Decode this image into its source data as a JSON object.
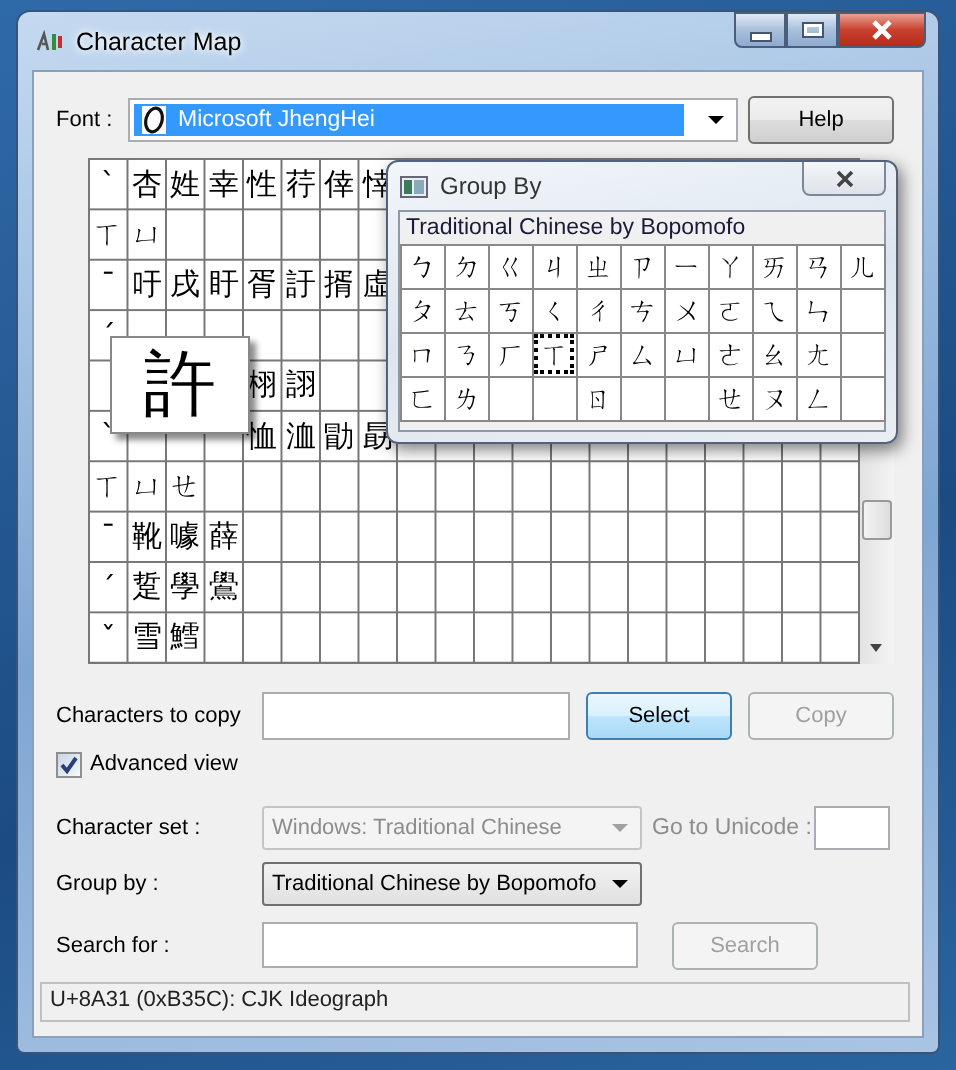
{
  "window": {
    "title": "Character Map"
  },
  "font": {
    "label": "Font :",
    "value": "Microsoft JhengHei"
  },
  "help_button": {
    "label": "Help",
    "disabled": false
  },
  "grid": {
    "rows": [
      [
        {
          "kind": "char",
          "text": "ˋ"
        },
        {
          "kind": "char",
          "text": "杏"
        },
        {
          "kind": "char",
          "text": "姓"
        },
        {
          "kind": "char",
          "text": "幸"
        },
        {
          "kind": "char",
          "text": "性"
        },
        {
          "kind": "char",
          "text": "荇"
        },
        {
          "kind": "char",
          "text": "倖"
        },
        {
          "kind": "char",
          "text": "悻"
        }
      ],
      [
        {
          "kind": "char",
          "text": "ㄒ"
        },
        {
          "kind": "char",
          "text": "ㄩ"
        }
      ],
      [
        {
          "kind": "char",
          "text": "ˉ"
        },
        {
          "kind": "char",
          "text": "吁"
        },
        {
          "kind": "char",
          "text": "戌"
        },
        {
          "kind": "char",
          "text": "盱"
        },
        {
          "kind": "char",
          "text": "胥"
        },
        {
          "kind": "char",
          "text": "訏"
        },
        {
          "kind": "char",
          "text": "揟"
        },
        {
          "kind": "char",
          "text": "虛"
        }
      ],
      [
        {
          "kind": "char",
          "text": "ˊ"
        }
      ],
      [
        {
          "kind": "blank"
        },
        {
          "kind": "blank"
        },
        {
          "kind": "blank"
        },
        {
          "kind": "blank"
        },
        {
          "kind": "char",
          "text": "栩"
        },
        {
          "kind": "char",
          "text": "詡"
        }
      ],
      [
        {
          "kind": "char",
          "text": "ˋ"
        },
        {
          "kind": "blank"
        },
        {
          "kind": "blank"
        },
        {
          "kind": "blank"
        },
        {
          "kind": "char",
          "text": "恤"
        },
        {
          "kind": "char",
          "text": "洫"
        },
        {
          "kind": "char",
          "text": "勖"
        },
        {
          "kind": "char",
          "text": "勗"
        }
      ],
      [
        {
          "kind": "char",
          "text": "ㄒ"
        },
        {
          "kind": "char",
          "text": "ㄩ"
        },
        {
          "kind": "char",
          "text": "ㄝ"
        }
      ],
      [
        {
          "kind": "char",
          "text": "ˉ"
        },
        {
          "kind": "char",
          "text": "靴"
        },
        {
          "kind": "char",
          "text": "噱"
        },
        {
          "kind": "char",
          "text": "薛"
        }
      ],
      [
        {
          "kind": "char",
          "text": "ˊ"
        },
        {
          "kind": "char",
          "text": "踅"
        },
        {
          "kind": "char",
          "text": "學"
        },
        {
          "kind": "char",
          "text": "鷽"
        }
      ],
      [
        {
          "kind": "char",
          "text": "ˇ"
        },
        {
          "kind": "char",
          "text": "雪"
        },
        {
          "kind": "char",
          "text": "鱈"
        }
      ]
    ]
  },
  "magnifier": {
    "text": "許"
  },
  "group_by_popup": {
    "title": "Group By",
    "heading": "Traditional Chinese by Bopomofo",
    "rows": [
      [
        {
          "kind": "char",
          "text": "ㄅ",
          "selected": false
        },
        {
          "kind": "char",
          "text": "ㄉ",
          "selected": false
        },
        {
          "kind": "char",
          "text": "ㄍ",
          "selected": false
        },
        {
          "kind": "char",
          "text": "ㄐ",
          "selected": false
        },
        {
          "kind": "char",
          "text": "ㄓ",
          "selected": false
        },
        {
          "kind": "char",
          "text": "ㄗ",
          "selected": false
        },
        {
          "kind": "char",
          "text": "ㄧ",
          "selected": false
        },
        {
          "kind": "char",
          "text": "ㄚ",
          "selected": false
        },
        {
          "kind": "char",
          "text": "ㄞ",
          "selected": false
        },
        {
          "kind": "char",
          "text": "ㄢ",
          "selected": false
        },
        {
          "kind": "char",
          "text": "ㄦ",
          "selected": false
        }
      ],
      [
        {
          "kind": "char",
          "text": "ㄆ",
          "selected": false
        },
        {
          "kind": "char",
          "text": "ㄊ",
          "selected": false
        },
        {
          "kind": "char",
          "text": "ㄎ",
          "selected": false
        },
        {
          "kind": "char",
          "text": "ㄑ",
          "selected": false
        },
        {
          "kind": "char",
          "text": "ㄔ",
          "selected": false
        },
        {
          "kind": "char",
          "text": "ㄘ",
          "selected": false
        },
        {
          "kind": "char",
          "text": "ㄨ",
          "selected": false
        },
        {
          "kind": "char",
          "text": "ㄛ",
          "selected": false
        },
        {
          "kind": "char",
          "text": "ㄟ",
          "selected": false
        },
        {
          "kind": "char",
          "text": "ㄣ",
          "selected": false
        },
        {
          "kind": "blank"
        }
      ],
      [
        {
          "kind": "char",
          "text": "ㄇ",
          "selected": false
        },
        {
          "kind": "char",
          "text": "ㄋ",
          "selected": false
        },
        {
          "kind": "char",
          "text": "ㄏ",
          "selected": false
        },
        {
          "kind": "char",
          "text": "ㄒ",
          "selected": true
        },
        {
          "kind": "char",
          "text": "ㄕ",
          "selected": false
        },
        {
          "kind": "char",
          "text": "ㄙ",
          "selected": false
        },
        {
          "kind": "char",
          "text": "ㄩ",
          "selected": false
        },
        {
          "kind": "char",
          "text": "ㄜ",
          "selected": false
        },
        {
          "kind": "char",
          "text": "ㄠ",
          "selected": false
        },
        {
          "kind": "char",
          "text": "ㄤ",
          "selected": false
        },
        {
          "kind": "blank"
        }
      ],
      [
        {
          "kind": "char",
          "text": "ㄈ",
          "selected": false
        },
        {
          "kind": "char",
          "text": "ㄌ",
          "selected": false
        },
        {
          "kind": "blank"
        },
        {
          "kind": "blank"
        },
        {
          "kind": "char",
          "text": "ㄖ",
          "selected": false
        },
        {
          "kind": "blank"
        },
        {
          "kind": "blank"
        },
        {
          "kind": "char",
          "text": "ㄝ",
          "selected": false
        },
        {
          "kind": "char",
          "text": "ㄡ",
          "selected": false
        },
        {
          "kind": "char",
          "text": "ㄥ",
          "selected": false
        },
        {
          "kind": "blank"
        }
      ]
    ]
  },
  "characters_to_copy": {
    "label": "Characters to copy"
  },
  "buttons": [
    {
      "label": "Select",
      "disabled": false
    },
    {
      "label": "Copy",
      "disabled": true
    }
  ],
  "advanced_view": {
    "label": "Advanced view",
    "checked": true
  },
  "character_set": {
    "label": "Character set :",
    "value": "Windows: Traditional Chinese",
    "disabled": true
  },
  "go_to_unicode": {
    "label": "Go to Unicode :",
    "disabled": true
  },
  "group_by": {
    "label": "Group by :",
    "value": "Traditional Chinese by Bopomofo",
    "disabled": false
  },
  "search": {
    "label": "Search for :",
    "button": "Search",
    "button_disabled": true
  },
  "status_bar": "U+8A31 (0xB35C): CJK Ideograph"
}
